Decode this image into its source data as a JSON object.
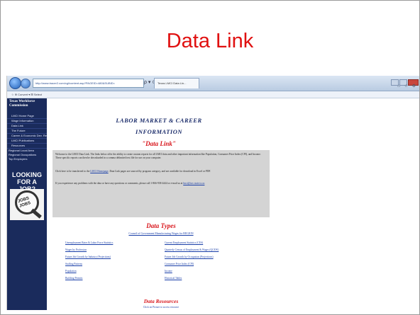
{
  "slide": {
    "title": "Data Link"
  },
  "browser": {
    "address": "http://www.tracer2.com/cgi/content.asp?PAGEID=480&SUBID=",
    "address_icons": "ρ ▾ ⊙ ✕",
    "tab_label": "Texas LMCI Data Lin...",
    "favorites_bar": "☆  ⊕ Convert  ▾  ⊞ Select",
    "right_icons": "⌂ ☆ ⚙"
  },
  "sidebar": {
    "org_title": "Texas Workforce Commission",
    "items": [
      "LMCI Home Page",
      "Wage Information",
      "Data Link",
      "The Future",
      "Career & Economic Dev. Resource",
      "LMCI Publications",
      "Resources"
    ],
    "items2": [
      "Regional Local Area",
      "Regional Occupations",
      "Top Employers"
    ],
    "ad_text": "LOOKING FOR A JOB?",
    "ad_image_text": "JOBS JOBS"
  },
  "content": {
    "heading_1": "LABOR MARKET & CAREER",
    "heading_2": "INFORMATION",
    "heading_3": "\"Data Link\"",
    "para_1": "Welcome to the LMCI Data Link. The links below offer the ability to create custom reports for all LMCI data and other important information like Population, Consumer Price Index (CPI), and Income. These specific reports can then be downloaded in a comma delimited text file for use on your computer.",
    "para_2_pre": "Click here to be transferred to the ",
    "para_2_link": "LMCI Homepage",
    "para_2_post": ". Data Link pages are sourced by program category, and are available for download in Excel or PDF.",
    "para_3_pre": "If you experience any problems with the data or have any questions or comments, please call 1-866-938-4444 or e-mail us at ",
    "para_3_link": "lmci@twc.state.tx.us",
    "data_types_heading": "Data Types",
    "data_types_sub": "Council of Government Manufacturing Wages for REGION",
    "left_links": [
      "Unemployment Rates & Labor Force Statistics",
      "Wages by Profession",
      "Future Job Growth by Industry (Projections)",
      "Staffing Patterns",
      "Population",
      "Building Permits"
    ],
    "right_links": [
      "Current Employment Statistics (CES)",
      "Quarterly Census of Employment & Wages (QCEW)",
      "Future Job Growth by Occupation (Projections)",
      "Consumer Price Index (CPI)",
      "Income",
      "Historical Tables"
    ],
    "data_resources_heading": "Data Resources",
    "data_resources_sub": "Click on Picture to access resource"
  }
}
